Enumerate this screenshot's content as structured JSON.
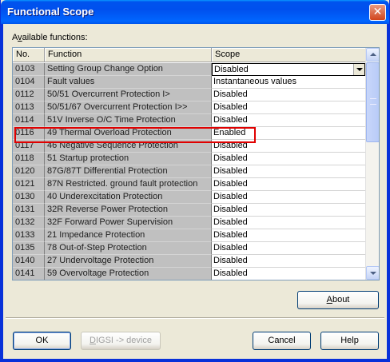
{
  "window": {
    "title": "Functional Scope",
    "close_glyph": "✕"
  },
  "available_label": "Available functions:",
  "table": {
    "columns": [
      "No.",
      "Function",
      "Scope"
    ],
    "rows": [
      {
        "no": "0103",
        "function": "Setting Group Change Option",
        "scope": "Disabled"
      },
      {
        "no": "0104",
        "function": "Fault values",
        "scope": "Instantaneous values"
      },
      {
        "no": "0112",
        "function": "50/51 Overcurrent Protection I>",
        "scope": "Disabled"
      },
      {
        "no": "0113",
        "function": "50/51/67 Overcurrent Protection I>>",
        "scope": "Disabled"
      },
      {
        "no": "0114",
        "function": "51V Inverse O/C Time Protection",
        "scope": "Disabled"
      },
      {
        "no": "0116",
        "function": "49 Thermal Overload Protection",
        "scope": "Enabled"
      },
      {
        "no": "0117",
        "function": "46 Negative Sequence  Protection",
        "scope": "Disabled"
      },
      {
        "no": "0118",
        "function": "51 Startup protection",
        "scope": "Disabled"
      },
      {
        "no": "0120",
        "function": "87G/87T Differential Protection",
        "scope": "Disabled"
      },
      {
        "no": "0121",
        "function": "87N Restricted. ground fault protection",
        "scope": "Disabled"
      },
      {
        "no": "0130",
        "function": "40 Underexcitation Protection",
        "scope": "Disabled"
      },
      {
        "no": "0131",
        "function": "32R Reverse Power Protection",
        "scope": "Disabled"
      },
      {
        "no": "0132",
        "function": "32F Forward Power Supervision",
        "scope": "Disabled"
      },
      {
        "no": "0133",
        "function": "21 Impedance Protection",
        "scope": "Disabled"
      },
      {
        "no": "0135",
        "function": "78 Out-of-Step Protection",
        "scope": "Disabled"
      },
      {
        "no": "0140",
        "function": "27 Undervoltage Protection",
        "scope": "Disabled"
      },
      {
        "no": "0141",
        "function": "59 Overvoltage Protection",
        "scope": "Disabled"
      }
    ]
  },
  "buttons": {
    "about": "About",
    "ok": "OK",
    "digsi": "DIGSI -> device",
    "cancel": "Cancel",
    "help": "Help"
  },
  "colors": {
    "title_bar": "#0053ee",
    "highlight_border": "#e00000",
    "readonly_cell": "#c0c0c0"
  },
  "icons": {
    "close": "close-icon",
    "dropdown": "chevron-down-icon",
    "scroll_up": "scroll-up-icon",
    "scroll_down": "scroll-down-icon"
  }
}
